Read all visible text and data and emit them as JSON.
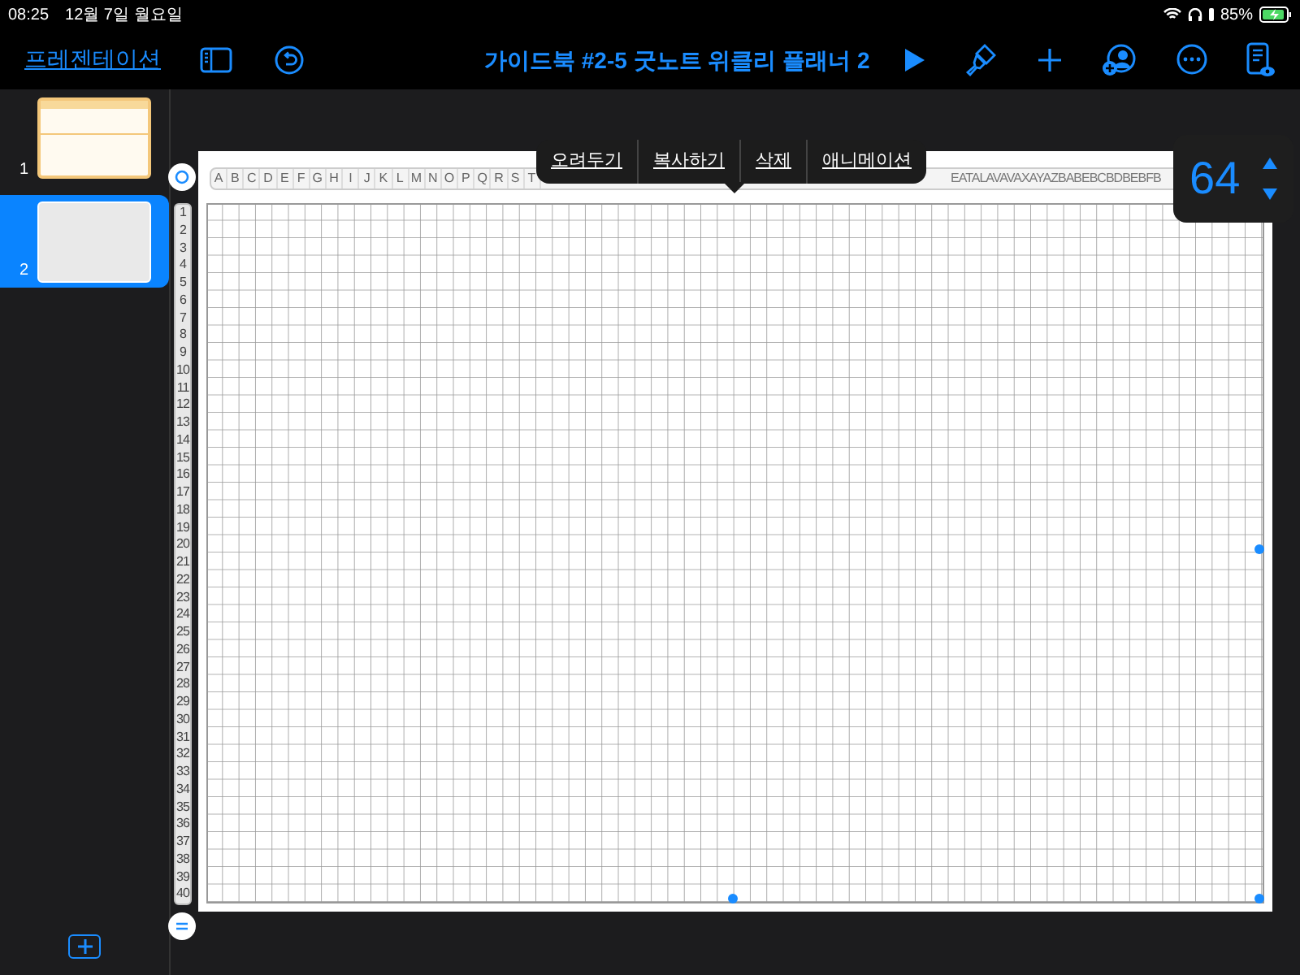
{
  "status_bar": {
    "time": "08:25",
    "date": "12월 7일 월요일",
    "battery": "85%"
  },
  "toolbar": {
    "back_label": "프레젠테이션",
    "title": "가이드북 #2-5 굿노트 위클리 플래너 2"
  },
  "slides": [
    {
      "number": "1",
      "selected": false,
      "kind": "planner"
    },
    {
      "number": "2",
      "selected": true,
      "kind": "grid"
    }
  ],
  "context_menu": {
    "items": [
      "오려두기",
      "복사하기",
      "삭제",
      "애니메이션"
    ]
  },
  "table": {
    "column_headers": [
      "A",
      "B",
      "C",
      "D",
      "E",
      "F",
      "G",
      "H",
      "I",
      "J",
      "K",
      "L",
      "M",
      "N",
      "O",
      "P",
      "Q",
      "R",
      "S",
      "T"
    ],
    "column_headers_end": "EATALAVAVAXAYAZBABEBCBDBEBFB",
    "row_headers": [
      "1",
      "2",
      "3",
      "4",
      "5",
      "6",
      "7",
      "8",
      "9",
      "10",
      "11",
      "12",
      "13",
      "14",
      "15",
      "16",
      "17",
      "18",
      "19",
      "20",
      "21",
      "22",
      "23",
      "24",
      "25",
      "26",
      "27",
      "28",
      "29",
      "30",
      "31",
      "32",
      "33",
      "34",
      "35",
      "36",
      "37",
      "38",
      "39",
      "40"
    ]
  },
  "stepper": {
    "value": "64"
  }
}
